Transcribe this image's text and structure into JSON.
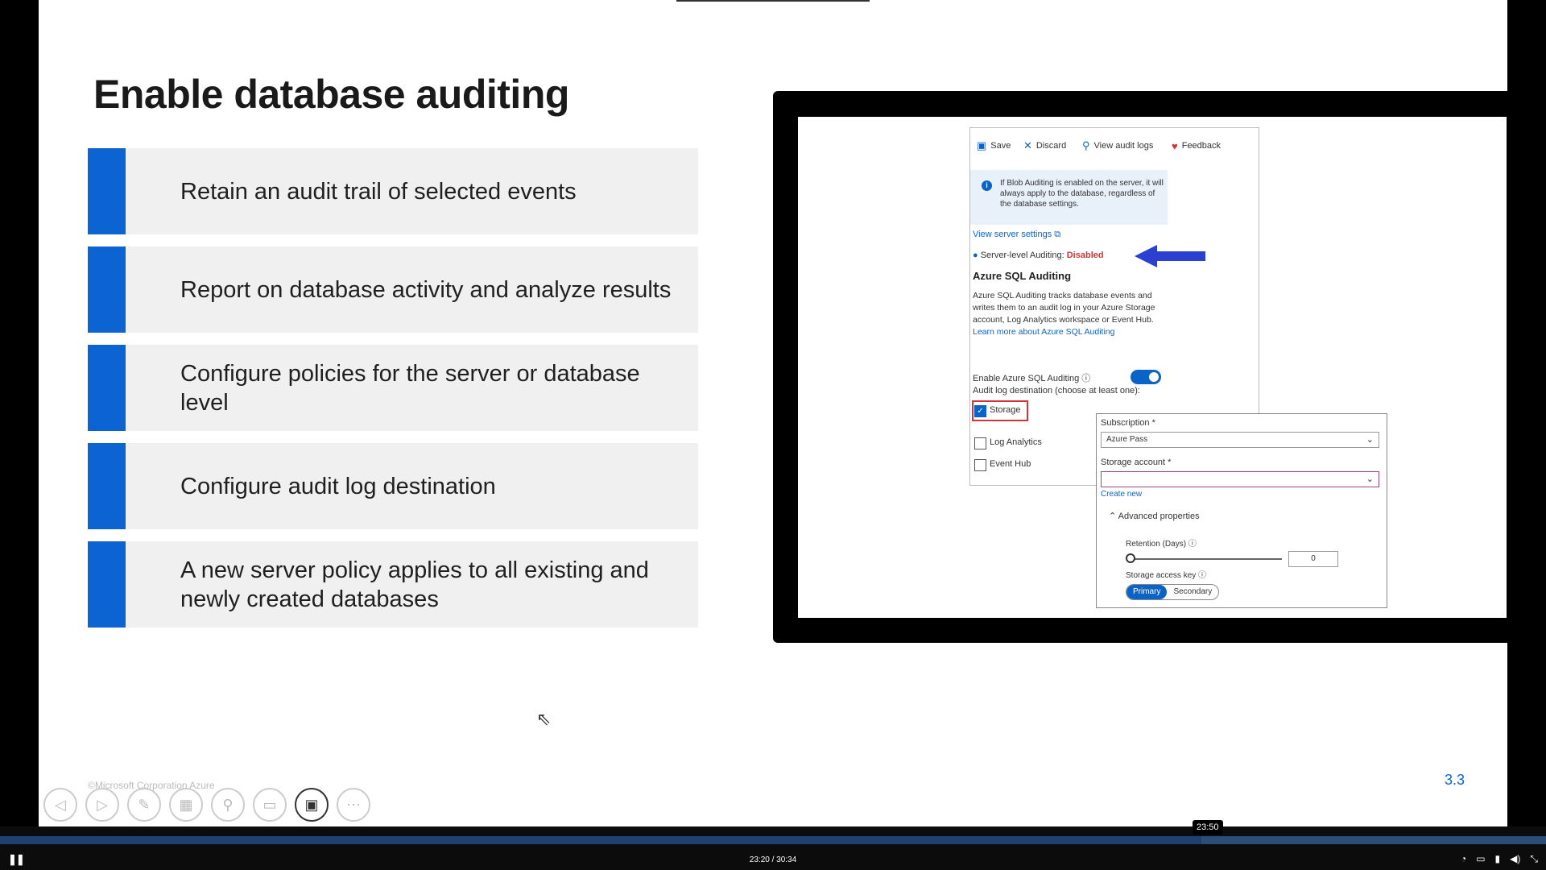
{
  "slide": {
    "title": "Enable database auditing",
    "bullets": [
      "Retain an audit trail of selected events",
      "Report on database activity and analyze results",
      "Configure policies for the server or database level",
      "Configure audit log destination",
      "A new server policy applies to all existing and newly created databases"
    ],
    "page_number": "3.3",
    "copyright": "©Microsoft Corporation Azure"
  },
  "screenshot": {
    "toolbar": {
      "save": "Save",
      "discard": "Discard",
      "view_audit_logs": "View audit logs",
      "feedback": "Feedback"
    },
    "info_text": "If Blob Auditing is enabled on the server, it will always apply to the database, regardless of the database settings.",
    "view_server_settings": "View server settings",
    "server_level_label": "Server-level Auditing:",
    "server_level_value": "Disabled",
    "section_title": "Azure SQL Auditing",
    "description": "Azure SQL Auditing tracks database events and writes them to an audit log in your Azure Storage account, Log Analytics workspace or Event Hub.",
    "learn_more": "Learn more about Azure SQL Auditing",
    "enable_label": "Enable Azure SQL Auditing",
    "destination_label": "Audit log destination (choose at least one):",
    "storage": "Storage",
    "log_analytics": "Log Analytics",
    "event_hub": "Event Hub",
    "subscription_label": "Subscription *",
    "subscription_value": "Azure Pass",
    "storage_account_label": "Storage account *",
    "create_new": "Create new",
    "advanced": "Advanced properties",
    "retention_label": "Retention (Days)",
    "retention_value": "0",
    "access_key_label": "Storage access key",
    "primary": "Primary",
    "secondary": "Secondary"
  },
  "player": {
    "time": "23:20 / 30:34",
    "hover_time": "23:50",
    "progress": 0.777
  },
  "colors": {
    "accent": "#0c64d2",
    "disabled_red": "#d13438"
  }
}
